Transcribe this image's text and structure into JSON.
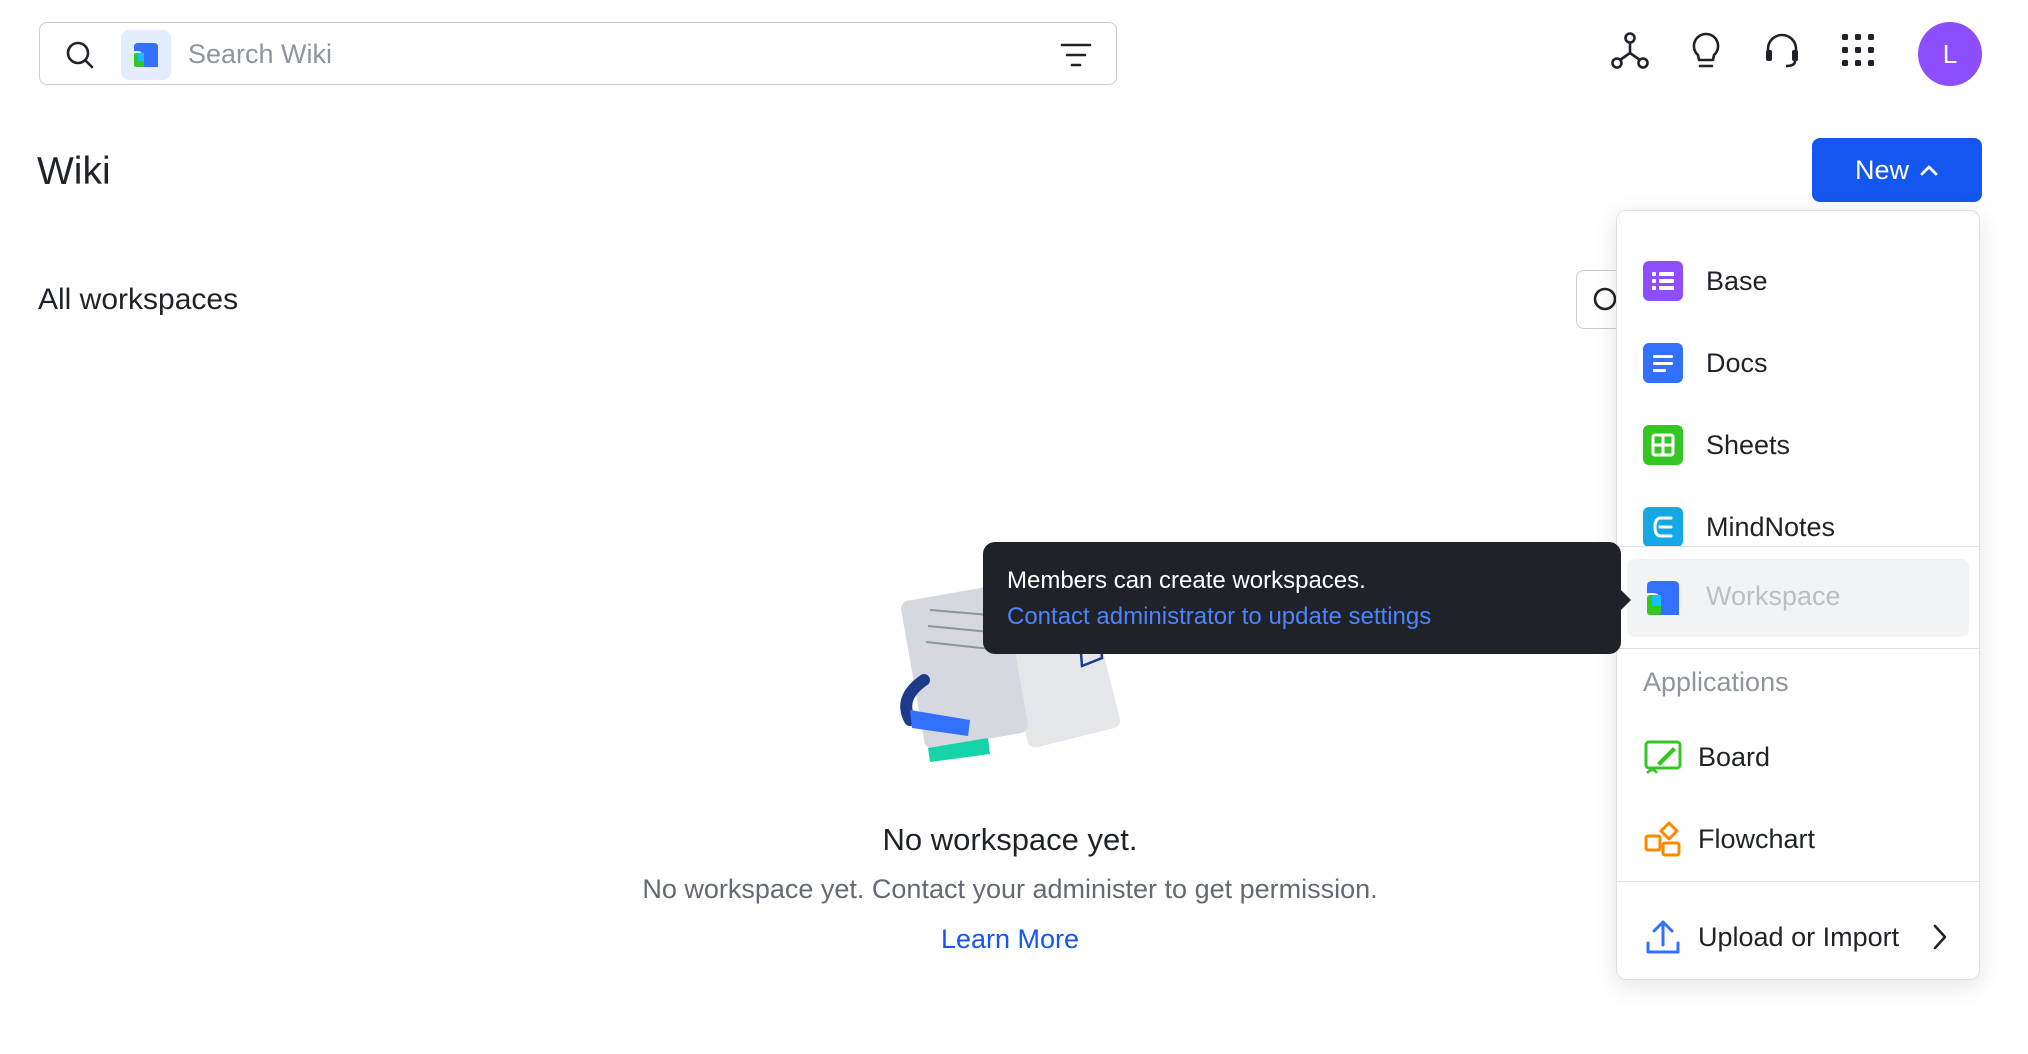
{
  "search": {
    "placeholder": "Search Wiki"
  },
  "header_icons": [
    "org-chart-icon",
    "lightbulb-icon",
    "headset-icon",
    "app-grid-icon"
  ],
  "user": {
    "avatar_letter": "L",
    "avatar_color": "#8d4eff"
  },
  "page": {
    "title": "Wiki",
    "new_button_label": "New",
    "section_title": "All workspaces"
  },
  "empty_state": {
    "title": "No workspace yet.",
    "description": "No workspace yet. Contact your administer to get permission.",
    "link_label": "Learn More"
  },
  "tooltip": {
    "line1": "Members can create workspaces.",
    "line2": "Contact administrator to update settings"
  },
  "new_menu": {
    "items": [
      {
        "label": "Base",
        "icon": "base-icon",
        "color": "#8d4eff"
      },
      {
        "label": "Docs",
        "icon": "docs-icon",
        "color": "#3370ff"
      },
      {
        "label": "Sheets",
        "icon": "sheets-icon",
        "color": "#34c724"
      },
      {
        "label": "MindNotes",
        "icon": "mindnotes-icon",
        "color": "#14a9e6"
      }
    ],
    "workspace": {
      "label": "Workspace",
      "icon": "workspace-icon",
      "disabled": true
    },
    "applications_label": "Applications",
    "applications": [
      {
        "label": "Board",
        "icon": "board-icon",
        "color": "#34c724"
      },
      {
        "label": "Flowchart",
        "icon": "flowchart-icon",
        "color": "#ff8800"
      }
    ],
    "upload": {
      "label": "Upload or Import",
      "icon": "upload-icon"
    }
  },
  "colors": {
    "primary": "#1456f0",
    "text": "#1f2329",
    "muted": "#646a73",
    "tooltip_bg": "#1f2329",
    "link": "#4e83fd"
  }
}
